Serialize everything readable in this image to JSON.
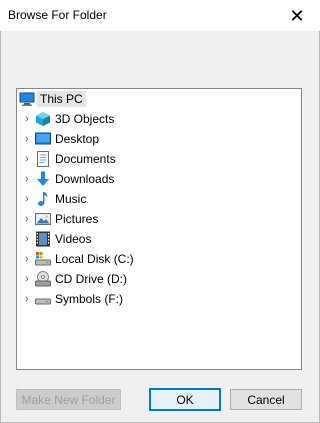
{
  "dialog": {
    "title": "Browse For Folder",
    "close_glyph": "✕"
  },
  "tree": {
    "root": {
      "label": "This PC",
      "icon": "computer-icon"
    },
    "items": [
      {
        "label": "3D Objects",
        "icon": "cube-icon",
        "expand": "›"
      },
      {
        "label": "Desktop",
        "icon": "desktop-icon",
        "expand": "›"
      },
      {
        "label": "Documents",
        "icon": "document-icon",
        "expand": "›"
      },
      {
        "label": "Downloads",
        "icon": "download-icon",
        "expand": "›"
      },
      {
        "label": "Music",
        "icon": "music-icon",
        "expand": "›"
      },
      {
        "label": "Pictures",
        "icon": "picture-icon",
        "expand": "›"
      },
      {
        "label": "Videos",
        "icon": "video-icon",
        "expand": "›"
      },
      {
        "label": "Local Disk (C:)",
        "icon": "drive-icon",
        "expand": "›"
      },
      {
        "label": "CD Drive (D:)",
        "icon": "cd-drive-icon",
        "expand": "›"
      },
      {
        "label": "Symbols (F:)",
        "icon": "drive-icon",
        "expand": "›"
      }
    ]
  },
  "buttons": {
    "new_folder": "Make New Folder",
    "ok": "OK",
    "cancel": "Cancel"
  },
  "colors": {
    "accent": "#0078d7",
    "selection": "#e5e5e5"
  }
}
